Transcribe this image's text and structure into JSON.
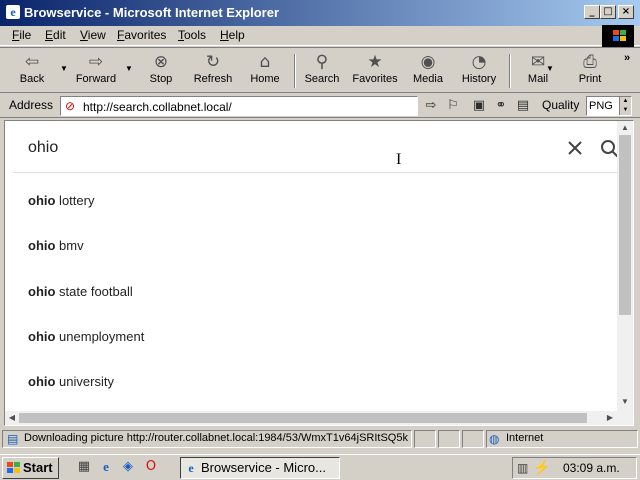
{
  "window": {
    "title": "Browservice - Microsoft Internet Explorer",
    "app_icon": "ie-icon",
    "controls": [
      "minimize",
      "maximize",
      "close"
    ]
  },
  "menu": {
    "items": [
      "File",
      "Edit",
      "View",
      "Favorites",
      "Tools",
      "Help"
    ]
  },
  "toolbar": {
    "buttons": [
      {
        "label": "Back",
        "icon": "back-arrow-icon"
      },
      {
        "label": "Forward",
        "icon": "forward-arrow-icon"
      },
      {
        "label": "Stop",
        "icon": "stop-icon"
      },
      {
        "label": "Refresh",
        "icon": "refresh-icon"
      },
      {
        "label": "Home",
        "icon": "home-icon"
      },
      {
        "label": "Search",
        "icon": "search-globe-icon"
      },
      {
        "label": "Favorites",
        "icon": "favorites-folder-icon"
      },
      {
        "label": "Media",
        "icon": "media-icon"
      },
      {
        "label": "History",
        "icon": "history-icon"
      },
      {
        "label": "Mail",
        "icon": "mail-icon"
      },
      {
        "label": "Print",
        "icon": "print-icon"
      }
    ],
    "overflow": "»"
  },
  "address": {
    "label": "Address",
    "url": "http://search.collabnet.local/",
    "quality_label": "Quality",
    "quality_value": "PNG"
  },
  "page": {
    "query": "ohio",
    "suggestions": [
      {
        "bold": "ohio",
        "rest": " lottery"
      },
      {
        "bold": "ohio",
        "rest": " bmv"
      },
      {
        "bold": "ohio",
        "rest": " state football"
      },
      {
        "bold": "ohio",
        "rest": " unemployment"
      },
      {
        "bold": "ohio",
        "rest": " university"
      }
    ]
  },
  "status": {
    "text": "Downloading picture http://router.collabnet.local:1984/53/WmxT1v64jSRItSQ5k",
    "zone": "Internet"
  },
  "taskbar": {
    "start_label": "Start",
    "task_label": "Browservice - Micro...",
    "clock": "03:09 a.m."
  },
  "colors": {
    "title_gradient_start": "#0a246a",
    "title_gradient_end": "#a6caf0",
    "chrome": "#d4d0c8"
  }
}
